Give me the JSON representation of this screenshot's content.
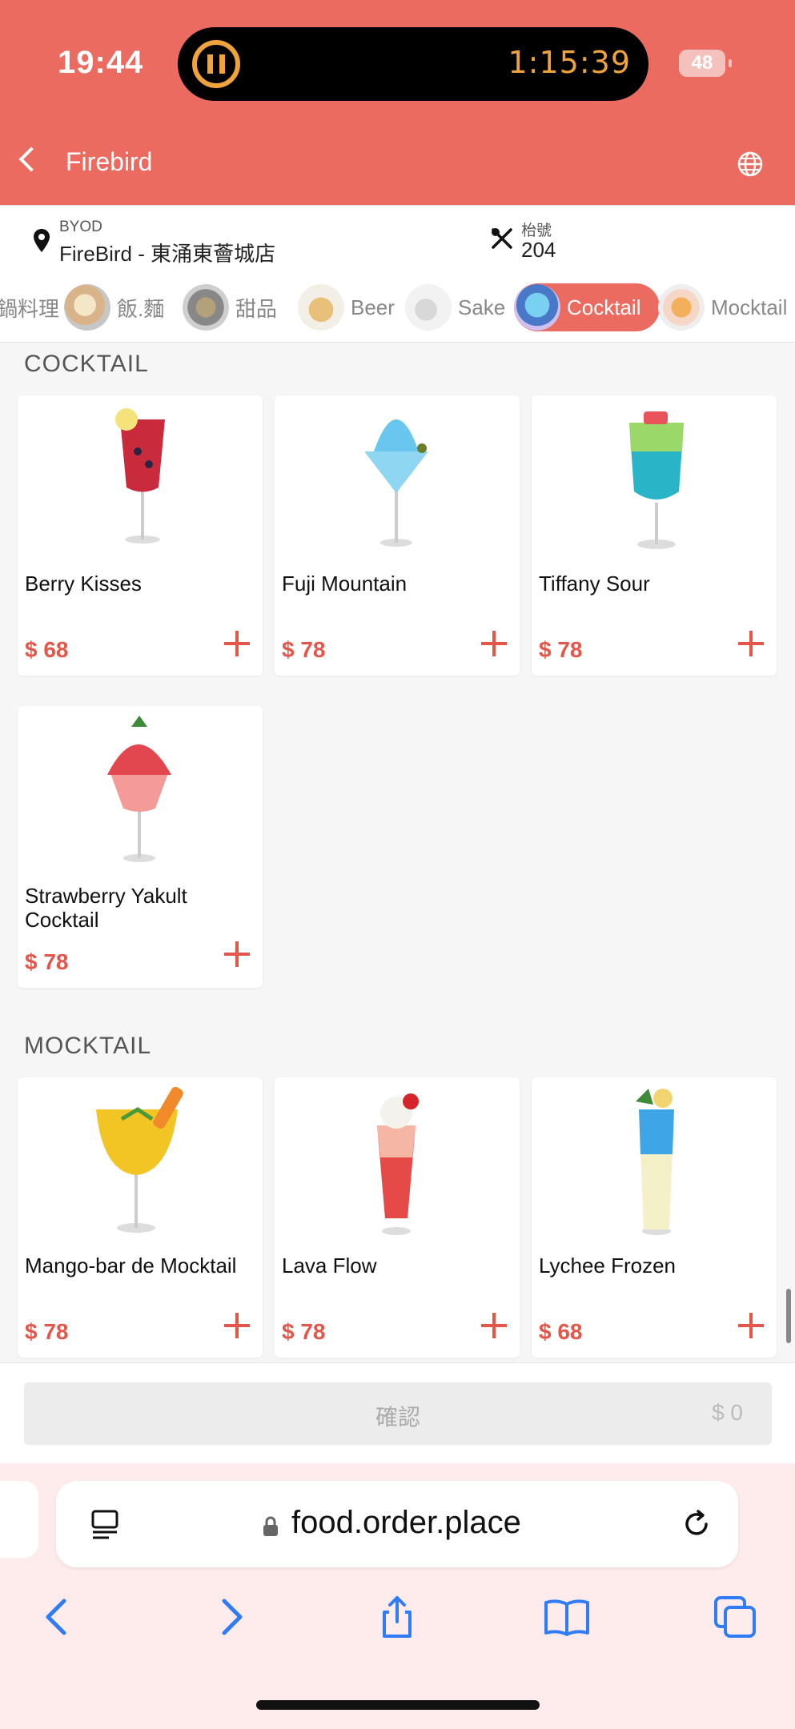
{
  "status": {
    "time": "19:44",
    "timer": "1:15:39",
    "battery": "48"
  },
  "header": {
    "title": "Firebird"
  },
  "info": {
    "mode_label": "BYOD",
    "store": "FireBird - 東涌東薈城店",
    "table_label": "枱號",
    "table_number": "204"
  },
  "categories": [
    {
      "label": "鍋料理",
      "active": false
    },
    {
      "label": "飯.麵",
      "active": false
    },
    {
      "label": "甜品",
      "active": false
    },
    {
      "label": "Beer",
      "active": false
    },
    {
      "label": "Sake",
      "active": false
    },
    {
      "label": "Cocktail",
      "active": true
    },
    {
      "label": "Mocktail",
      "active": false
    }
  ],
  "sections": {
    "cocktail": {
      "title": "COCKTAIL",
      "items": [
        {
          "name": "Berry Kisses",
          "price": "$ 68"
        },
        {
          "name": "Fuji Mountain",
          "price": "$ 78"
        },
        {
          "name": "Tiffany Sour",
          "price": "$ 78"
        },
        {
          "name": "Strawberry Yakult Cocktail",
          "price": "$ 78"
        }
      ]
    },
    "mocktail": {
      "title": "MOCKTAIL",
      "items": [
        {
          "name": "Mango-bar de Mocktail",
          "price": "$ 78"
        },
        {
          "name": "Lava Flow",
          "price": "$ 78"
        },
        {
          "name": "Lychee Frozen",
          "price": "$ 68"
        }
      ]
    }
  },
  "confirm": {
    "label": "確認",
    "total": "$ 0"
  },
  "browser": {
    "url": "food.order.place"
  },
  "colors": {
    "brand": "#ec6b60",
    "price": "#e4564a",
    "ios_blue": "#2f7cf6"
  }
}
